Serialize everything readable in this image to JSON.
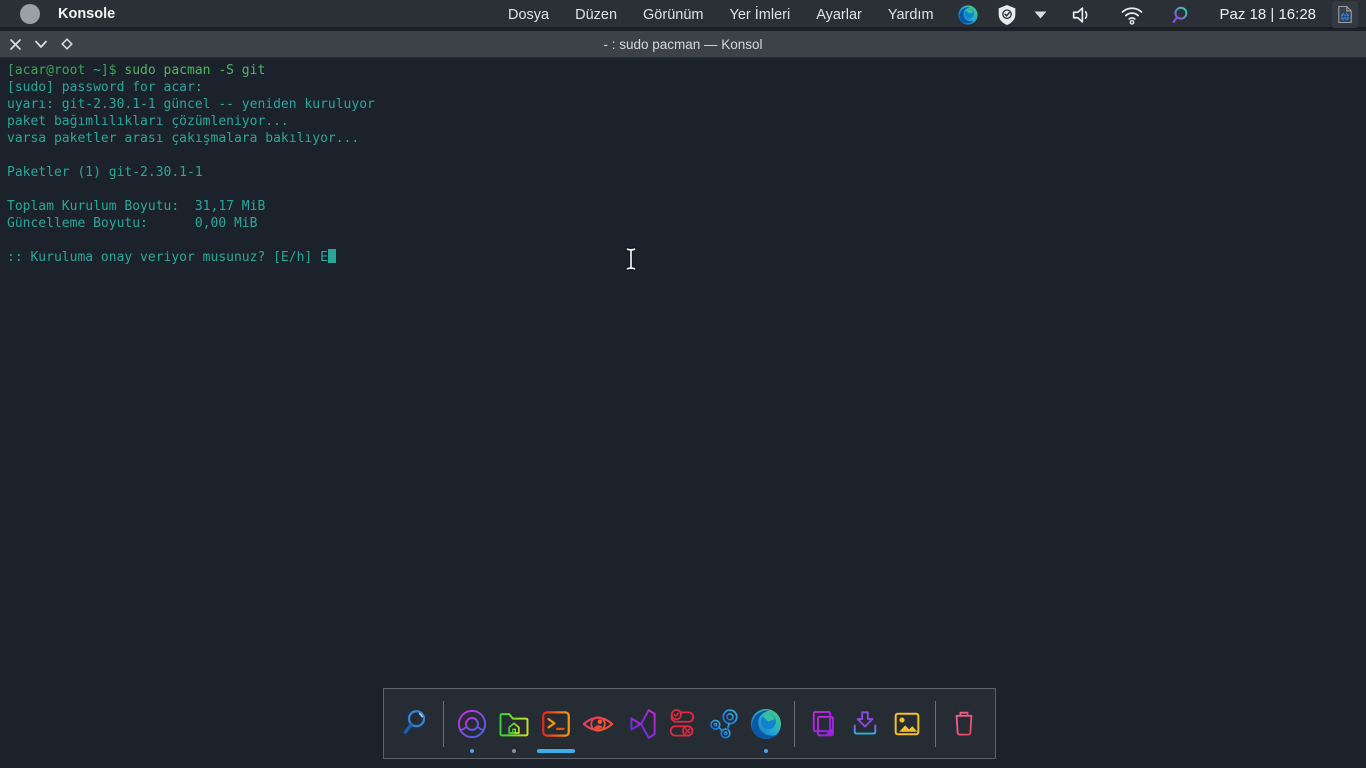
{
  "topbar": {
    "app_name": "Konsole",
    "menu_items": [
      "Dosya",
      "Düzen",
      "Görünüm",
      "Yer İmleri",
      "Ayarlar",
      "Yardım"
    ],
    "tray_icons": [
      "edge-browser-icon",
      "shield-check-icon",
      "chevron-down-icon",
      "volume-icon",
      "wifi-icon",
      "search-magnifier-icon"
    ],
    "clock": "Paz 18 | 16:28",
    "corner_icon": "document-globe-icon"
  },
  "titlebar": {
    "controls": [
      "close",
      "shade",
      "maximize"
    ],
    "title": "- : sudo pacman — Konsol"
  },
  "terminal": {
    "colors": {
      "teal": "#2aa79b",
      "prompt_green": "#3da457",
      "prompt_tilde": "#2fb394",
      "command_green": "#4db663"
    },
    "cursor_color": "#2aa79b",
    "lines": [
      {
        "parts": [
          {
            "t": "[acar@root ",
            "c": "prompt_green"
          },
          {
            "t": "~",
            "c": "prompt_tilde"
          },
          {
            "t": "]$ ",
            "c": "prompt_green"
          },
          {
            "t": "sudo pacman -S git",
            "c": "command_green"
          }
        ]
      },
      {
        "parts": [
          {
            "t": "[sudo] password for acar:",
            "c": "teal"
          }
        ]
      },
      {
        "parts": [
          {
            "t": "uyarı: git-2.30.1-1 güncel -- yeniden kuruluyor",
            "c": "teal"
          }
        ]
      },
      {
        "parts": [
          {
            "t": "paket bağımlılıkları çözümleniyor...",
            "c": "teal"
          }
        ]
      },
      {
        "parts": [
          {
            "t": "varsa paketler arası çakışmalara bakılıyor...",
            "c": "teal"
          }
        ]
      },
      {
        "parts": []
      },
      {
        "parts": [
          {
            "t": "Paketler (1) git-2.30.1-1",
            "c": "teal"
          }
        ]
      },
      {
        "parts": []
      },
      {
        "parts": [
          {
            "t": "Toplam Kurulum Boyutu:  31,17 MiB",
            "c": "teal"
          }
        ]
      },
      {
        "parts": [
          {
            "t": "Güncelleme Boyutu:      0,00 MiB",
            "c": "teal"
          }
        ]
      },
      {
        "parts": []
      },
      {
        "parts": [
          {
            "t": ":: Kuruluma onay veriyor musunuz? [E/h] E",
            "c": "teal"
          }
        ],
        "cursor": true
      }
    ]
  },
  "dock": {
    "accent_active": "#3daee9",
    "items": [
      {
        "name": "search-launcher",
        "indicator": "none"
      },
      {
        "name": "chromium-browser",
        "indicator": "dot-blue"
      },
      {
        "name": "file-manager-home",
        "indicator": "dot-gray"
      },
      {
        "name": "terminal-konsole",
        "indicator": "active-bar"
      },
      {
        "name": "eye-image-viewer",
        "indicator": "none"
      },
      {
        "name": "visual-studio",
        "indicator": "none"
      },
      {
        "name": "toggles-settings",
        "indicator": "none"
      },
      {
        "name": "steam",
        "indicator": "none"
      },
      {
        "name": "edge-browser",
        "indicator": "dot-blue"
      },
      {
        "name": "copy-pages",
        "indicator": "none"
      },
      {
        "name": "downloads",
        "indicator": "none"
      },
      {
        "name": "image-gallery",
        "indicator": "none"
      },
      {
        "name": "trash",
        "indicator": "none"
      }
    ]
  }
}
